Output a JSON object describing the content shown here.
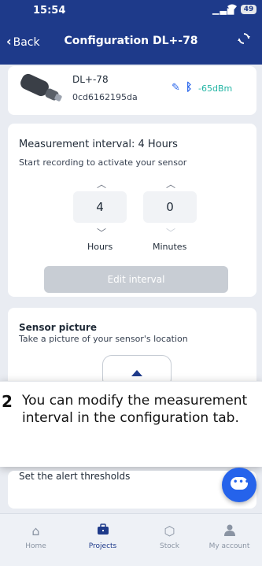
{
  "status_bar": {
    "time": "15:54",
    "battery": "49"
  },
  "header": {
    "back_label": "Back",
    "title": "Configuration DL+-78"
  },
  "sensor": {
    "name": "DL+-78",
    "id": "0cd6162195da",
    "rssi": "-65dBm"
  },
  "measurement": {
    "title": "Measurement interval: 4 Hours",
    "subtitle": "Start recording to activate your sensor",
    "hours_value": "4",
    "minutes_value": "0",
    "hours_label": "Hours",
    "minutes_label": "Minutes",
    "edit_button_label": "Edit interval"
  },
  "picture": {
    "title": "Sensor picture",
    "subtitle": "Take a picture of your sensor's location"
  },
  "overlay": {
    "step_number": "2",
    "message": "You can modify the measurement interval in the configuration tab."
  },
  "alerts": {
    "text": "Set the alert thresholds"
  },
  "bottom_nav": [
    {
      "label": "Home",
      "icon": "home-icon"
    },
    {
      "label": "Projects",
      "icon": "briefcase-icon"
    },
    {
      "label": "Stock",
      "icon": "box-icon"
    },
    {
      "label": "My account",
      "icon": "user-icon"
    }
  ],
  "colors": {
    "primary": "#1e3a8a",
    "accent": "#2563eb",
    "signal": "#22b5a4",
    "disabled": "#c8cdd4"
  }
}
